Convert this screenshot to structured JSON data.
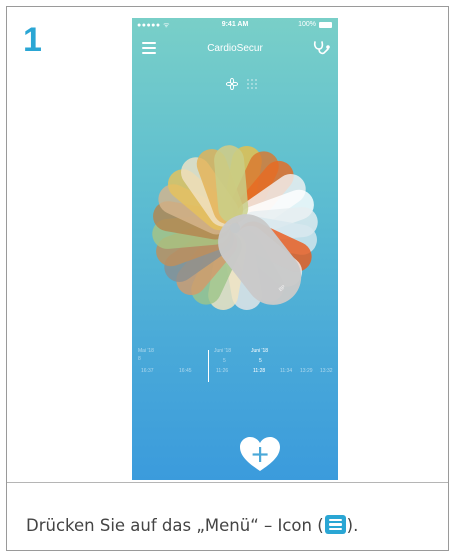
{
  "step": {
    "number": "1"
  },
  "instruction": {
    "before_icon": "Drücken Sie auf das „Menü“ – Icon (",
    "icon": "menu-icon",
    "after_icon": ")."
  },
  "status_bar": {
    "signal": "●●●●● ᯤ",
    "time": "9:41 AM",
    "battery": "100%"
  },
  "app": {
    "title": "CardioSecur"
  },
  "timeline": {
    "left": {
      "month": "Mai '18",
      "day": "8",
      "times": [
        "16:37",
        "16:45"
      ]
    },
    "middle": {
      "month": "Juni '18",
      "day": "5",
      "times": [
        "11:26"
      ]
    },
    "right": {
      "month": "Juni '18",
      "day": "5",
      "times": [
        "11:28",
        "11:34",
        "13:29",
        "13:32"
      ]
    }
  },
  "colors": {
    "accent": "#2aa6d4",
    "gradient_top": "#79cfc8",
    "gradient_bottom": "#3b9bdc",
    "selected_petal": "#c8c8c8",
    "orange_petal": "#e4501a"
  }
}
